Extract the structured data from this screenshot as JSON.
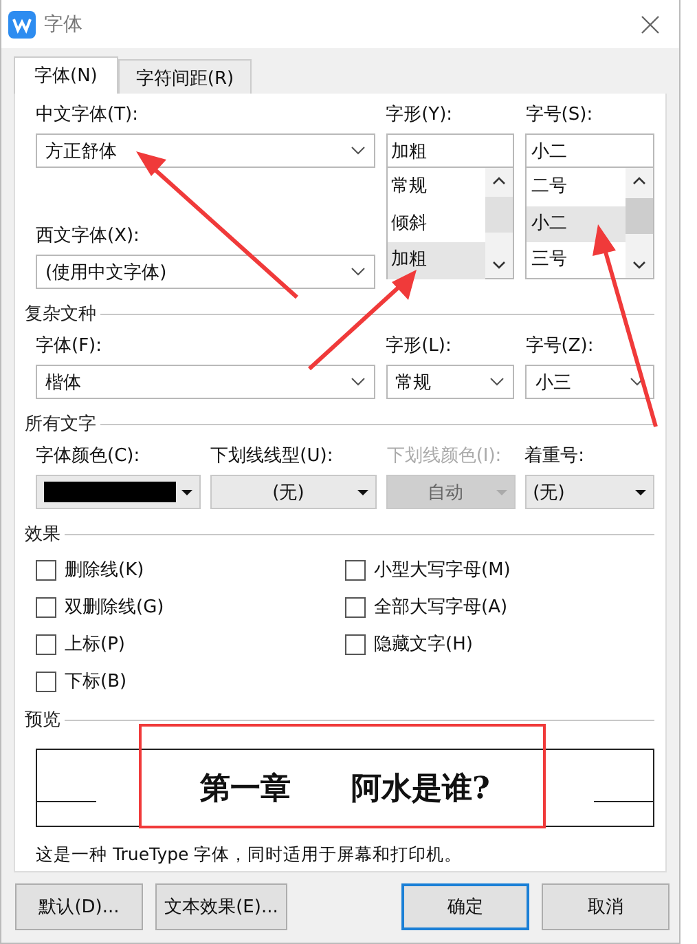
{
  "window": {
    "title": "字体"
  },
  "tabs": [
    {
      "label": "字体(N)",
      "selected": true
    },
    {
      "label": "字符间距(R)",
      "selected": false
    }
  ],
  "chinese_font": {
    "label": "中文字体(T):",
    "value": "方正舒体"
  },
  "western_font": {
    "label": "西文字体(X):",
    "value": "(使用中文字体)"
  },
  "style": {
    "label": "字形(Y):",
    "value": "加粗",
    "options": [
      {
        "label": "常规",
        "selected": false
      },
      {
        "label": "倾斜",
        "selected": false
      },
      {
        "label": "加粗",
        "selected": true
      }
    ]
  },
  "size": {
    "label": "字号(S):",
    "value": "小二",
    "options": [
      {
        "label": "二号",
        "selected": false
      },
      {
        "label": "小二",
        "selected": true
      },
      {
        "label": "三号",
        "selected": false
      }
    ]
  },
  "complex_script": {
    "title": "复杂文种",
    "fields": [
      {
        "label": "字体(F):",
        "value": "楷体"
      },
      {
        "label": "字形(L):",
        "value": "常规"
      },
      {
        "label": "字号(Z):",
        "value": "小三"
      }
    ]
  },
  "all_text": {
    "title": "所有文字",
    "fields": [
      {
        "kind": "color",
        "label": "字体颜色(C):",
        "color": "#000000",
        "disabled": false
      },
      {
        "kind": "dropdown",
        "label": "下划线线型(U):",
        "value": "(无)",
        "disabled": false
      },
      {
        "kind": "dropdown",
        "label": "下划线颜色(I):",
        "value": "自动",
        "disabled": true
      },
      {
        "kind": "dropdown",
        "label": "着重号:",
        "value": "(无)",
        "disabled": false
      }
    ]
  },
  "effects": {
    "title": "效果",
    "columns": [
      [
        {
          "label": "删除线(K)",
          "checked": false
        },
        {
          "label": "双删除线(G)",
          "checked": false
        },
        {
          "label": "上标(P)",
          "checked": false
        },
        {
          "label": "下标(B)",
          "checked": false
        }
      ],
      [
        {
          "label": "小型大写字母(M)",
          "checked": false
        },
        {
          "label": "全部大写字母(A)",
          "checked": false
        },
        {
          "label": "隐藏文字(H)",
          "checked": false
        }
      ]
    ]
  },
  "preview": {
    "title": "预览",
    "sample": "第一章　　阿水是谁?",
    "description": "这是一种 TrueType 字体，同时适用于屏幕和打印机。"
  },
  "buttons": [
    {
      "label": "默认(D)...",
      "default": false
    },
    {
      "label": "文本效果(E)...",
      "default": false
    },
    {
      "label": "确定",
      "default": true
    },
    {
      "label": "取消",
      "default": false
    }
  ]
}
